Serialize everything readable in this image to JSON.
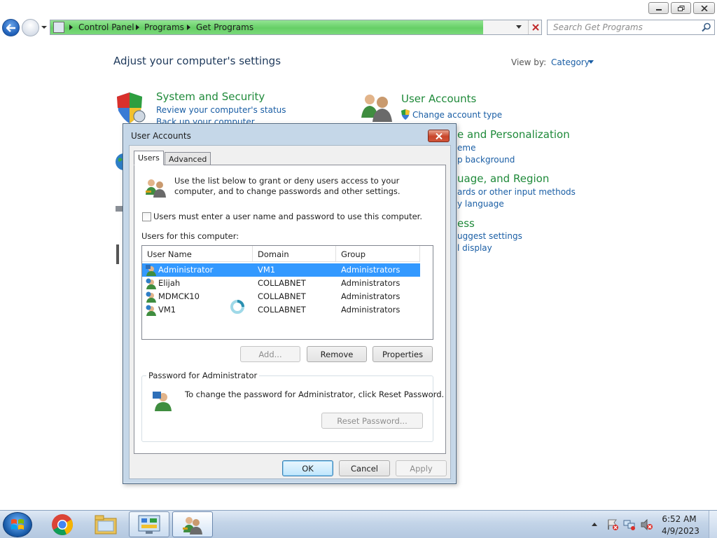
{
  "window": {
    "breadcrumb": [
      "Control Panel",
      "Programs",
      "Get Programs"
    ],
    "search_placeholder": "Search Get Programs"
  },
  "control_panel": {
    "heading": "Adjust your computer's settings",
    "view_by_label": "View by:",
    "view_by_value": "Category",
    "categories": [
      {
        "title": "System and Security",
        "links": [
          "Review your computer's status",
          "Back up your computer"
        ]
      },
      {
        "title": "User Accounts",
        "links": [
          "Change account type"
        ]
      },
      {
        "title": "e and Personalization",
        "links": [
          "eme",
          "p background"
        ]
      },
      {
        "title": "uage, and Region",
        "links": [
          "ards or other input methods",
          "y language"
        ]
      },
      {
        "title": "ess",
        "links": [
          "uggest settings",
          "l display"
        ]
      }
    ]
  },
  "dialog": {
    "title": "User Accounts",
    "tabs": [
      "Users",
      "Advanced"
    ],
    "intro": "Use the list below to grant or deny users access to your computer, and to change passwords and other settings.",
    "checkbox_label": "Users must enter a user name and password to use this computer.",
    "checkbox_checked": false,
    "users_label": "Users for this computer:",
    "columns": [
      "User Name",
      "Domain",
      "Group"
    ],
    "users": [
      {
        "name": "Administrator",
        "domain": "VM1",
        "group": "Administrators",
        "selected": true
      },
      {
        "name": "Elijah",
        "domain": "COLLABNET",
        "group": "Administrators",
        "selected": false
      },
      {
        "name": "MDMCK10",
        "domain": "COLLABNET",
        "group": "Administrators",
        "selected": false
      },
      {
        "name": "VM1",
        "domain": "COLLABNET",
        "group": "Administrators",
        "selected": false
      }
    ],
    "buttons": {
      "add": "Add...",
      "remove": "Remove",
      "properties": "Properties"
    },
    "password_group": {
      "legend": "Password for Administrator",
      "text": "To change the password for Administrator, click Reset Password.",
      "reset_button": "Reset Password..."
    },
    "footer": {
      "ok": "OK",
      "cancel": "Cancel",
      "apply": "Apply"
    }
  },
  "taskbar": {
    "apps": [
      "chrome-icon",
      "windows-explorer-icon",
      "control-panel-icon",
      "user-accounts-icon"
    ],
    "clock_time": "6:52 AM",
    "clock_date": "4/9/2023"
  },
  "colors": {
    "selection": "#3399ff",
    "link": "#1a5ea5",
    "category_title": "#1f8a3a",
    "address_progress": "#66cf66"
  }
}
